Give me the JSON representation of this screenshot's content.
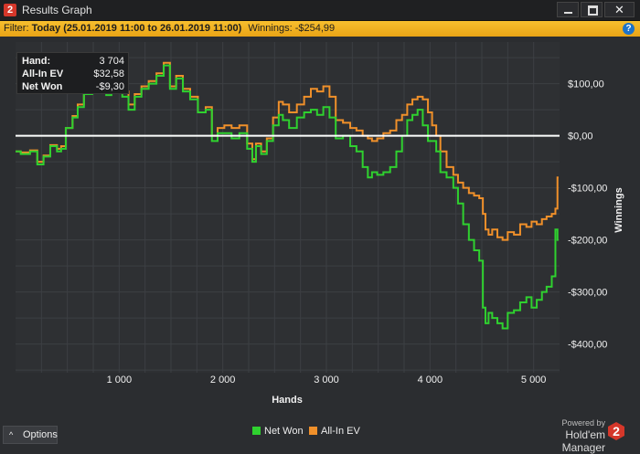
{
  "window": {
    "logo": "2",
    "title": "Results Graph",
    "controls": {
      "close": "✕"
    }
  },
  "filter": {
    "label": "Filter:",
    "value": "Today (25.01.2019 11:00 to 26.01.2019 11:00)",
    "winnings_label": "Winnings:",
    "winnings_value": "-$254,99",
    "help": "?"
  },
  "info_box": {
    "hand_label": "Hand:",
    "hand_value": "3 704",
    "allin_label": "All-In EV",
    "allin_value": "$32,58",
    "net_label": "Net Won",
    "net_value": "-$9,30"
  },
  "options": {
    "label": "Options",
    "chevron": "^"
  },
  "powered": {
    "small": "Powered by",
    "brand": "Hold'em Manager",
    "logo": "2"
  },
  "colors": {
    "net_won": "#2fd12f",
    "allin_ev": "#f0902a",
    "zero_line": "#ffffff",
    "bg": "#2b2d30"
  },
  "chart_data": {
    "type": "line",
    "xlabel": "Hands",
    "ylabel": "Winnings",
    "xlim": [
      0,
      5250
    ],
    "ylim": [
      -455,
      180
    ],
    "x_ticks": [
      1000,
      2000,
      3000,
      4000,
      5000
    ],
    "x_tick_labels": [
      "1 000",
      "2 000",
      "3 000",
      "4 000",
      "5 000"
    ],
    "y_ticks": [
      100,
      0,
      -100,
      -200,
      -300,
      -400
    ],
    "y_tick_labels": [
      "$100,00",
      "$0,00",
      "-$100,00",
      "-$200,00",
      "-$300,00",
      "-$400,00"
    ],
    "grid": true,
    "legend": "bottom-center",
    "series": [
      {
        "name": "Net Won",
        "x": [
          0,
          100,
          180,
          240,
          300,
          370,
          430,
          450,
          520,
          580,
          620,
          700,
          780,
          850,
          900,
          950,
          1000,
          1060,
          1120,
          1180,
          1250,
          1320,
          1400,
          1460,
          1520,
          1580,
          1650,
          1720,
          1800,
          1870,
          1920,
          1980,
          2050,
          2120,
          2200,
          2270,
          2300,
          2340,
          2400,
          2450,
          2520,
          2560,
          2600,
          2680,
          2750,
          2820,
          2880,
          2940,
          3000,
          3060,
          3120,
          3200,
          3260,
          3320,
          3380,
          3420,
          3460,
          3520,
          3580,
          3650,
          3700,
          3760,
          3800,
          3860,
          3900,
          3960,
          4000,
          4040,
          4080,
          4120,
          4200,
          4250,
          4290,
          4350,
          4400,
          4450,
          4500,
          4520,
          4550,
          4580,
          4620,
          4680,
          4720,
          4780,
          4840,
          4900,
          4960,
          5000,
          5060,
          5100,
          5150,
          5200,
          5220,
          5240
        ],
        "values": [
          -30,
          -35,
          -30,
          -55,
          -40,
          -20,
          -30,
          -25,
          15,
          35,
          55,
          80,
          90,
          88,
          78,
          95,
          105,
          75,
          50,
          75,
          90,
          100,
          115,
          135,
          90,
          110,
          85,
          70,
          45,
          50,
          -10,
          5,
          5,
          -5,
          5,
          -25,
          -50,
          -20,
          -35,
          -10,
          20,
          40,
          30,
          15,
          35,
          45,
          50,
          40,
          55,
          35,
          -5,
          0,
          -20,
          -30,
          -60,
          -80,
          -70,
          -75,
          -70,
          -60,
          -30,
          0,
          30,
          40,
          50,
          20,
          -10,
          -10,
          -30,
          -70,
          -80,
          -100,
          -130,
          -170,
          -200,
          -220,
          -240,
          -330,
          -360,
          -340,
          -350,
          -360,
          -370,
          -340,
          -335,
          -320,
          -310,
          -330,
          -315,
          -300,
          -290,
          -270,
          -180,
          -200
        ]
      },
      {
        "name": "All-In EV",
        "x": [
          0,
          100,
          180,
          240,
          300,
          370,
          430,
          450,
          520,
          580,
          620,
          700,
          780,
          850,
          900,
          950,
          1000,
          1060,
          1120,
          1180,
          1250,
          1320,
          1400,
          1460,
          1520,
          1580,
          1650,
          1720,
          1800,
          1870,
          1920,
          1980,
          2050,
          2120,
          2200,
          2270,
          2300,
          2340,
          2400,
          2450,
          2520,
          2560,
          2600,
          2680,
          2750,
          2820,
          2880,
          2940,
          3000,
          3060,
          3120,
          3200,
          3260,
          3320,
          3380,
          3420,
          3460,
          3520,
          3580,
          3650,
          3700,
          3760,
          3800,
          3860,
          3900,
          3960,
          4000,
          4040,
          4080,
          4120,
          4200,
          4250,
          4290,
          4350,
          4400,
          4450,
          4500,
          4520,
          4550,
          4580,
          4620,
          4680,
          4720,
          4780,
          4840,
          4900,
          4960,
          5000,
          5060,
          5100,
          5150,
          5200,
          5220,
          5240
        ],
        "values": [
          -30,
          -32,
          -28,
          -50,
          -38,
          -18,
          -25,
          -20,
          15,
          38,
          60,
          85,
          95,
          92,
          82,
          100,
          110,
          85,
          60,
          80,
          95,
          105,
          120,
          140,
          95,
          115,
          90,
          75,
          45,
          55,
          0,
          15,
          20,
          15,
          20,
          -15,
          -45,
          -15,
          -30,
          -5,
          35,
          65,
          60,
          45,
          60,
          75,
          90,
          85,
          95,
          75,
          30,
          25,
          15,
          10,
          0,
          -5,
          -10,
          -5,
          5,
          10,
          30,
          40,
          60,
          70,
          75,
          70,
          45,
          20,
          0,
          -30,
          -60,
          -75,
          -90,
          -100,
          -110,
          -115,
          -120,
          -150,
          -180,
          -190,
          -180,
          -195,
          -200,
          -185,
          -190,
          -170,
          -175,
          -165,
          -170,
          -160,
          -155,
          -150,
          -140,
          -80
        ]
      }
    ]
  }
}
